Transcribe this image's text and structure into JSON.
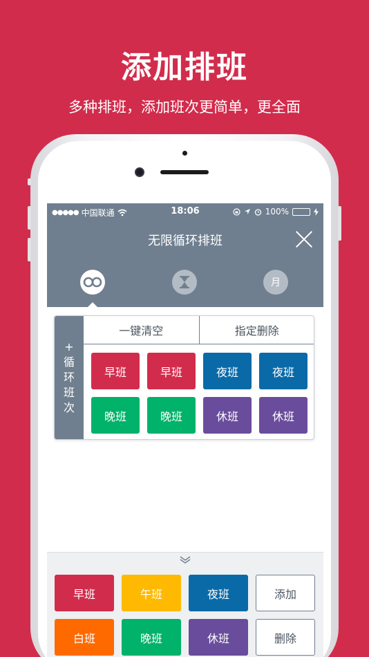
{
  "promo": {
    "title": "添加排班",
    "subtitle": "多种排班，添加班次更简单，更全面"
  },
  "status_bar": {
    "carrier": "中国联通",
    "time": "18:06",
    "battery": "100%",
    "battery_level": 1.0
  },
  "nav": {
    "title": "无限循环排班",
    "mode_month_label": "月"
  },
  "cycle": {
    "side_label_lines": [
      "+",
      "循",
      "环",
      "班",
      "次"
    ],
    "clear_label": "一键清空",
    "delete_label": "指定删除",
    "shifts": [
      {
        "label": "早班",
        "color": "#d22c4c"
      },
      {
        "label": "早班",
        "color": "#d22c4c"
      },
      {
        "label": "夜班",
        "color": "#0a6aa8"
      },
      {
        "label": "夜班",
        "color": "#0a6aa8"
      },
      {
        "label": "晚班",
        "color": "#00b26a"
      },
      {
        "label": "晚班",
        "color": "#00b26a"
      },
      {
        "label": "休班",
        "color": "#6a4c9c"
      },
      {
        "label": "休班",
        "color": "#6a4c9c"
      }
    ]
  },
  "palette": {
    "shifts": [
      {
        "label": "早班",
        "color": "#d22c4c"
      },
      {
        "label": "午班",
        "color": "#ffb900"
      },
      {
        "label": "夜班",
        "color": "#0a6aa8"
      },
      {
        "label": "白班",
        "color": "#ff6a00"
      },
      {
        "label": "晚班",
        "color": "#00b26a"
      },
      {
        "label": "休班",
        "color": "#6a4c9c"
      }
    ],
    "add_label": "添加",
    "delete_label": "删除"
  },
  "colors": {
    "brand": "#d22c4c",
    "header": "#6f7f8f"
  }
}
